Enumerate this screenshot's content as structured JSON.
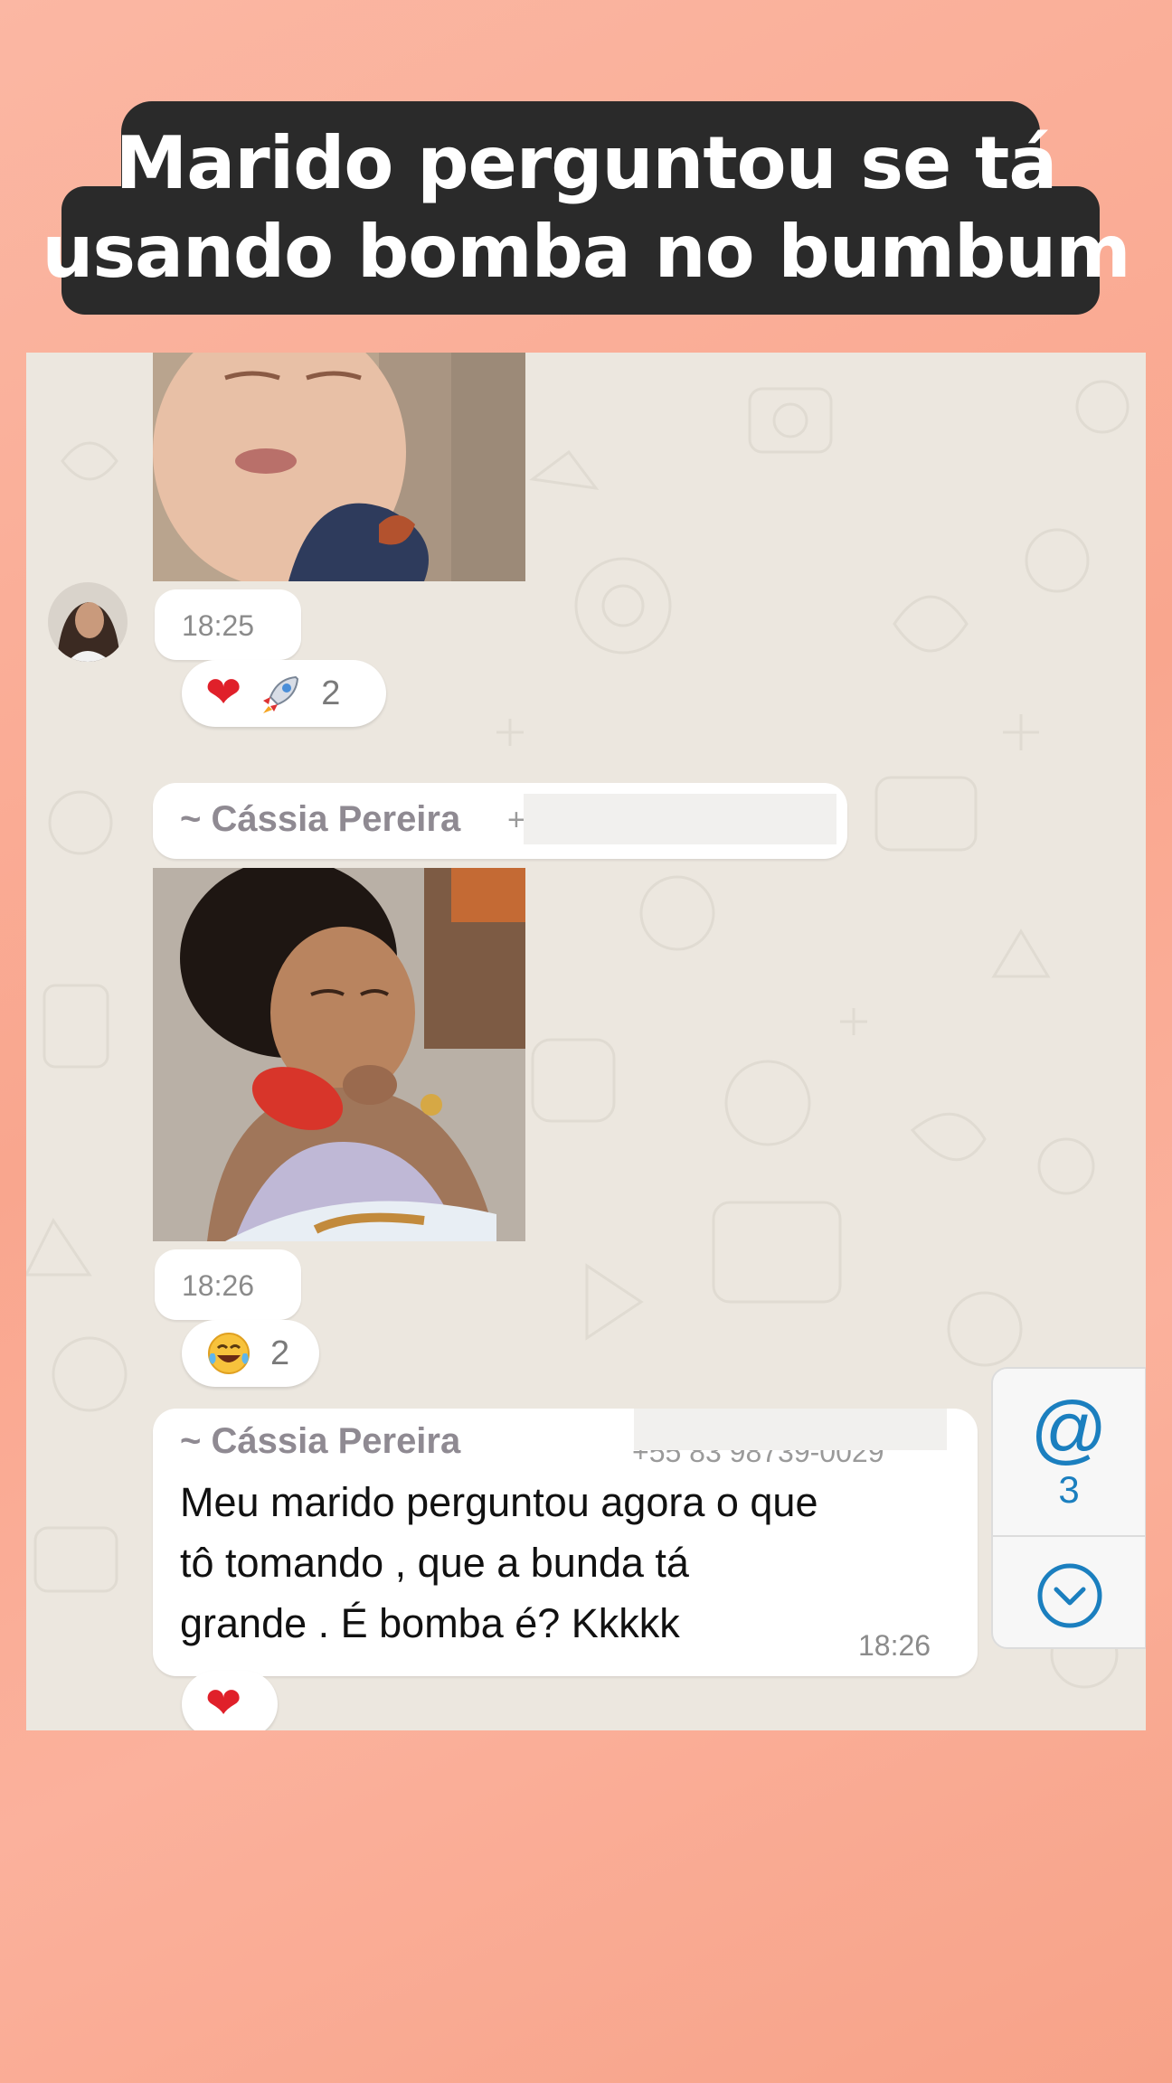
{
  "caption": {
    "line1": "Marido perguntou se tá",
    "line2": "usando bomba no bumbum"
  },
  "chat": {
    "messages": [
      {
        "type": "image",
        "time": "18:25",
        "reactions": {
          "emojis": [
            "heart",
            "rocket"
          ],
          "count": "2"
        }
      },
      {
        "type": "image",
        "sender": "~ Cássia Pereira",
        "sender_phone_partial": "+",
        "time": "18:26",
        "reactions": {
          "emojis": [
            "laughing-tears"
          ],
          "count": "2"
        }
      },
      {
        "type": "text",
        "sender": "~ Cássia Pereira",
        "sender_phone_partial": "+55 83 98739-0029",
        "text_lines": [
          "Meu marido perguntou agora o que",
          "tô tomando , que a bunda tá",
          "grande . É bomba é? Kkkkk"
        ],
        "time": "18:26",
        "reactions": {
          "emojis": [
            "heart"
          ]
        }
      }
    ]
  },
  "side_panel": {
    "mention_symbol": "@",
    "mention_count": "3",
    "scroll_down_icon": "chevron-down-circle-icon"
  },
  "colors": {
    "background": "#f9a68e",
    "caption_bg": "#2a2a2a",
    "chat_bg": "#ece7df",
    "accent": "#1b7fbf"
  }
}
